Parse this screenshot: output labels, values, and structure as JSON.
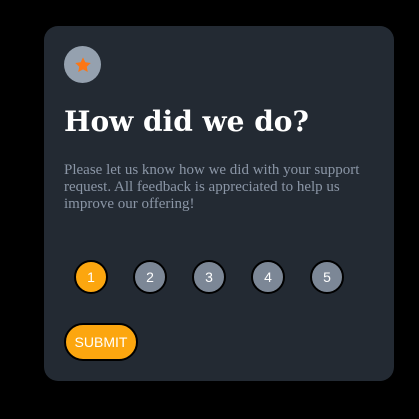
{
  "card": {
    "icon": "star-icon",
    "title": "How did we do?",
    "description": "Please let us know how we did with your support request. All feedback is appreciated to help us improve our offering!",
    "ratings": [
      {
        "label": "1",
        "selected": true
      },
      {
        "label": "2",
        "selected": false
      },
      {
        "label": "3",
        "selected": false
      },
      {
        "label": "4",
        "selected": false
      },
      {
        "label": "5",
        "selected": false
      }
    ],
    "submit_label": "SUBMIT"
  },
  "colors": {
    "page_background": "#000000",
    "card_background": "#232a33",
    "accent": "#fca60f",
    "rating_unselected": "#7c8796",
    "icon_badge": "#95a1af",
    "description_text": "#8b96a6"
  }
}
